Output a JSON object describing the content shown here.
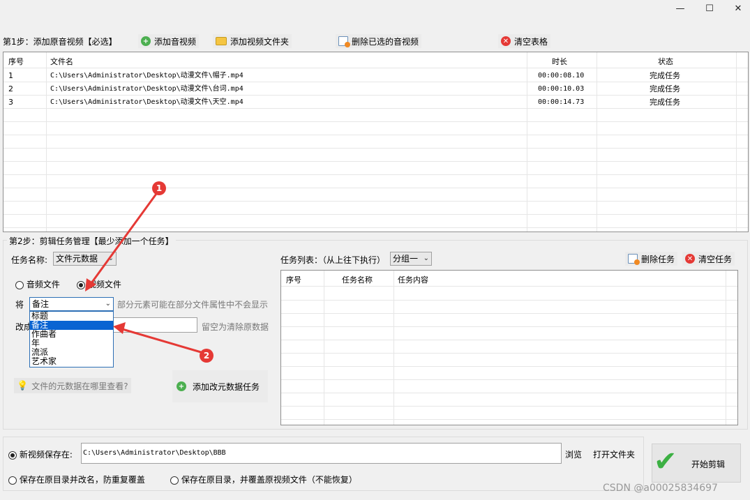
{
  "window": {
    "minimize": "—",
    "maximize": "☐",
    "close": "✕"
  },
  "step1": {
    "label": "第1步：添加原音视频【必选】",
    "add_audio": "添加音视频",
    "add_folder": "添加视频文件夹",
    "delete_selected": "删除已选的音视频",
    "clear_table": "清空表格"
  },
  "file_table": {
    "columns": [
      "序号",
      "文件名",
      "时长",
      "状态"
    ],
    "rows": [
      {
        "index": "1",
        "file": "C:\\Users\\Administrator\\Desktop\\动漫文件\\帽子.mp4",
        "duration": "00:00:08.10",
        "status": "完成任务"
      },
      {
        "index": "2",
        "file": "C:\\Users\\Administrator\\Desktop\\动漫文件\\台词.mp4",
        "duration": "00:00:10.03",
        "status": "完成任务"
      },
      {
        "index": "3",
        "file": "C:\\Users\\Administrator\\Desktop\\动漫文件\\天空.mp4",
        "duration": "00:00:14.73",
        "status": "完成任务"
      }
    ]
  },
  "step2": {
    "label": "第2步：剪辑任务管理【最少添加一个任务】",
    "task_name_label": "任务名称:",
    "task_name_value": "文件元数据",
    "radio_audio": "音频文件",
    "radio_video": "视频文件",
    "jiang_label": "将",
    "field_value": "备注",
    "hint1": "部分元素可能在部分文件属性中不会显示",
    "change_label": "改成",
    "hint2": "留空为清除原数据",
    "dropdown_options": [
      "标题",
      "备注",
      "作曲者",
      "年",
      "流派",
      "艺术家"
    ],
    "help_link": "文件的元数据在哪里查看?",
    "add_task": "添加改元数据任务",
    "task_list_label": "任务列表：（从上往下执行）",
    "group_value": "分组一",
    "delete_task": "删除任务",
    "clear_tasks": "清空任务",
    "task_columns": [
      "序号",
      "任务名称",
      "任务内容"
    ]
  },
  "output": {
    "save_to_label": "新视频保存在:",
    "path": "C:\\Users\\Administrator\\Desktop\\BBB",
    "browse": "浏览",
    "open_folder": "打开文件夹",
    "opt_rename": "保存在原目录并改名，防重复覆盖",
    "opt_overwrite": "保存在原目录，并覆盖原视频文件（不能恢复）",
    "start": "开始剪辑"
  },
  "annotations": {
    "badge1": "1",
    "badge2": "2"
  },
  "watermark": "CSDN @a00025834697"
}
